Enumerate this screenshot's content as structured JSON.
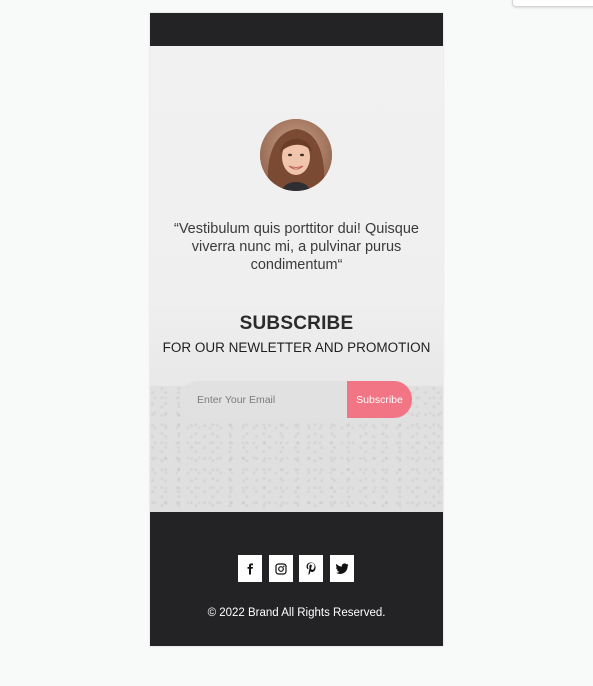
{
  "testimonial": {
    "quote": "“Vestibulum quis porttitor dui! Quisque viverra nunc mi, a pulvinar purus condimentum“"
  },
  "subscribe": {
    "title": "SUBSCRIBE",
    "caption": "FOR OUR NEWLETTER AND PROMOTION",
    "email_placeholder": "Enter Your Email",
    "email_value": "",
    "button_label": "Subscribe"
  },
  "footer": {
    "social_icons": [
      "facebook-icon",
      "instagram-icon",
      "pinterest-icon",
      "twitter-icon"
    ],
    "copyright": "© 2022 Brand All Rights Reserved."
  },
  "colors": {
    "dark": "#232325",
    "accent": "#f17584",
    "input_bg": "#e1e1e1"
  }
}
